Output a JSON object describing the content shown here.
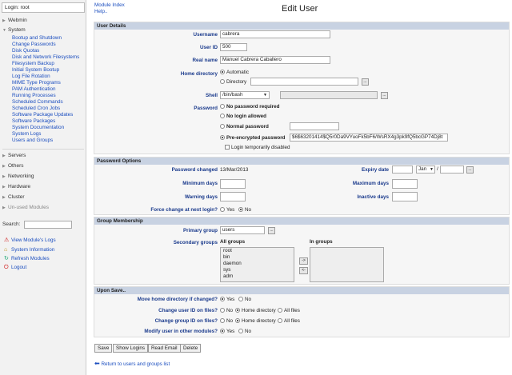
{
  "sidebar": {
    "login": "Login: root",
    "categories": [
      "Webmin",
      "System",
      "Servers",
      "Others",
      "Networking",
      "Hardware",
      "Cluster",
      "Un-used Modules"
    ],
    "system_items": [
      "Bootup and Shutdown",
      "Change Passwords",
      "Disk Quotas",
      "Disk and Network Filesystems",
      "Filesystem Backup",
      "Initial System Bootup",
      "Log File Rotation",
      "MIME Type Programs",
      "PAM Authentication",
      "Running Processes",
      "Scheduled Commands",
      "Scheduled Cron Jobs",
      "Software Package Updates",
      "Software Packages",
      "System Documentation",
      "System Logs",
      "Users and Groups"
    ],
    "search_label": "Search:",
    "bottom_links": [
      "View Module's Logs",
      "System Information",
      "Refresh Modules",
      "Logout"
    ]
  },
  "top_links": {
    "module_index": "Module Index",
    "help": "Help.."
  },
  "title": "Edit User",
  "user_details": {
    "header": "User Details",
    "username_label": "Username",
    "username": "cabrera",
    "uid_label": "User ID",
    "uid": "500",
    "realname_label": "Real name",
    "realname": "Manuel Cabrera Caballero",
    "home_label": "Home directory",
    "home_auto": "Automatic",
    "home_dir": "Directory",
    "shell_label": "Shell",
    "shell": "/bin/bash",
    "password_label": "Password",
    "pw_none": "No password required",
    "pw_nologin": "No login allowed",
    "pw_normal": "Normal password",
    "pw_pre": "Pre-encrypted password",
    "pw_hash": "$6$63201414$Q5r0Da9VYuoFk5bF6/WsRX4g3pk9fQ5bcGP74Dj8t",
    "pw_disable": "Login temporarily disabled"
  },
  "password_options": {
    "header": "Password Options",
    "changed_label": "Password changed",
    "changed": "13/Mar/2013",
    "expiry_label": "Expiry date",
    "expiry_month": "Jan",
    "slash": "/",
    "min_label": "Minimum days",
    "max_label": "Maximum days",
    "warn_label": "Warning days",
    "inactive_label": "Inactive days",
    "force_label": "Force change at next login?",
    "yes": "Yes",
    "no": "No"
  },
  "group_membership": {
    "header": "Group Membership",
    "primary_label": "Primary group",
    "primary": "users",
    "secondary_label": "Secondary groups",
    "all_groups": "All groups",
    "in_groups": "In groups",
    "groups": [
      "root",
      "bin",
      "daemon",
      "sys",
      "adm"
    ],
    "add": "->",
    "remove": "<-"
  },
  "upon_save": {
    "header": "Upon Save..",
    "move_label": "Move home directory if changed?",
    "uid_files_label": "Change user ID on files?",
    "gid_files_label": "Change group ID on files?",
    "modify_label": "Modify user in other modules?",
    "yes": "Yes",
    "no": "No",
    "home_dir": "Home directory",
    "all_files": "All files"
  },
  "buttons": [
    "Save",
    "Show Logins",
    "Read Email",
    "Delete"
  ],
  "return_link": "Return to users and groups list"
}
